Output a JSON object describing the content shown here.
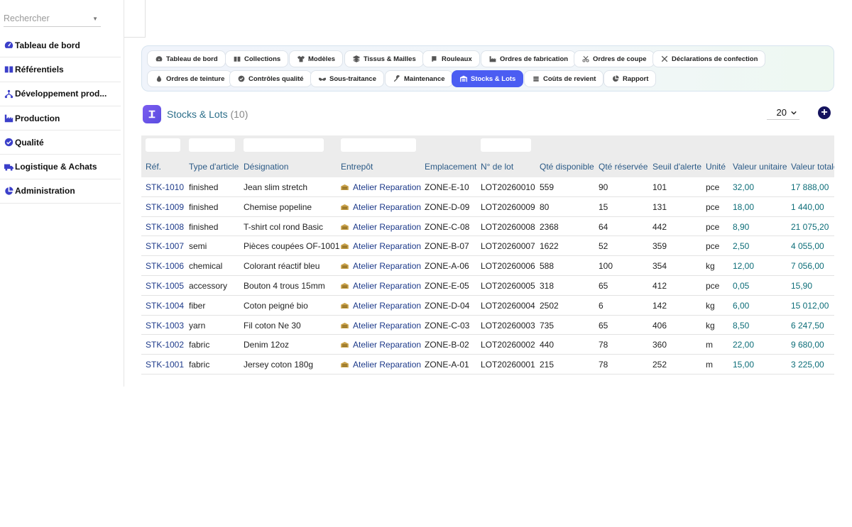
{
  "sidebar": {
    "search_placeholder": "Rechercher",
    "items": [
      {
        "label": "Tableau de bord",
        "icon": "gauge-icon"
      },
      {
        "label": "Référentiels",
        "icon": "book-icon"
      },
      {
        "label": "Développement prod...",
        "icon": "sitemap-icon"
      },
      {
        "label": "Production",
        "icon": "industry-icon"
      },
      {
        "label": "Qualité",
        "icon": "check-circle-icon"
      },
      {
        "label": "Logistique & Achats",
        "icon": "truck-icon"
      },
      {
        "label": "Administration",
        "icon": "pie-icon"
      }
    ]
  },
  "tabs": [
    {
      "label": "Tableau de bord",
      "icon": "gauge-icon"
    },
    {
      "label": "Collections",
      "icon": "book-icon"
    },
    {
      "label": "Modèles",
      "icon": "shirt-icon"
    },
    {
      "label": "Tissus & Mailles",
      "icon": "layers-icon"
    },
    {
      "label": "Rouleaux",
      "icon": "scroll-icon"
    },
    {
      "label": "Ordres de fabrication",
      "icon": "industry-icon"
    },
    {
      "label": "Ordres de coupe",
      "icon": "scissors-icon"
    },
    {
      "label": "Déclarations de confection",
      "icon": "tools-icon"
    },
    {
      "label": "Ordres de teinture",
      "icon": "droplet-icon"
    },
    {
      "label": "Contrôles qualité",
      "icon": "check-circle-icon"
    },
    {
      "label": "Sous-traitance",
      "icon": "handshake-icon"
    },
    {
      "label": "Maintenance",
      "icon": "wrench-icon"
    },
    {
      "label": "Stocks & Lots",
      "icon": "warehouse-icon",
      "active": true
    },
    {
      "label": "Coûts de revient",
      "icon": "coins-icon"
    },
    {
      "label": "Rapport",
      "icon": "pie-icon"
    }
  ],
  "section": {
    "title": "Stocks & Lots",
    "count": "(10)",
    "page_size": "20"
  },
  "colors": {
    "accent": "#4b5df2",
    "link": "#1d3a8a",
    "money": "#0c6d78",
    "header_text": "#2b5a86"
  },
  "table": {
    "columns": [
      "Réf.",
      "Type d'article",
      "Désignation",
      "Entrepôt",
      "Emplacement",
      "N° de lot",
      "Qté disponible",
      "Qté réservée",
      "Seuil d'alerte",
      "Unité",
      "Valeur unitaire",
      "Valeur totale"
    ],
    "rows": [
      [
        "STK-1010",
        "finished",
        "Jean slim stretch",
        "Atelier Reparation",
        "ZONE-E-10",
        "LOT20260010",
        "559",
        "90",
        "101",
        "pce",
        "32,00",
        "17 888,00"
      ],
      [
        "STK-1009",
        "finished",
        "Chemise popeline",
        "Atelier Reparation",
        "ZONE-D-09",
        "LOT20260009",
        "80",
        "15",
        "131",
        "pce",
        "18,00",
        "1 440,00"
      ],
      [
        "STK-1008",
        "finished",
        "T-shirt col rond Basic",
        "Atelier Reparation",
        "ZONE-C-08",
        "LOT20260008",
        "2368",
        "64",
        "442",
        "pce",
        "8,90",
        "21 075,20"
      ],
      [
        "STK-1007",
        "semi",
        "Pièces coupées OF-1001",
        "Atelier Reparation",
        "ZONE-B-07",
        "LOT20260007",
        "1622",
        "52",
        "359",
        "pce",
        "2,50",
        "4 055,00"
      ],
      [
        "STK-1006",
        "chemical",
        "Colorant réactif bleu",
        "Atelier Reparation",
        "ZONE-A-06",
        "LOT20260006",
        "588",
        "100",
        "354",
        "kg",
        "12,00",
        "7 056,00"
      ],
      [
        "STK-1005",
        "accessory",
        "Bouton 4 trous 15mm",
        "Atelier Reparation",
        "ZONE-E-05",
        "LOT20260005",
        "318",
        "65",
        "412",
        "pce",
        "0,05",
        "15,90"
      ],
      [
        "STK-1004",
        "fiber",
        "Coton peigné bio",
        "Atelier Reparation",
        "ZONE-D-04",
        "LOT20260004",
        "2502",
        "6",
        "142",
        "kg",
        "6,00",
        "15 012,00"
      ],
      [
        "STK-1003",
        "yarn",
        "Fil coton Ne 30",
        "Atelier Reparation",
        "ZONE-C-03",
        "LOT20260003",
        "735",
        "65",
        "406",
        "kg",
        "8,50",
        "6 247,50"
      ],
      [
        "STK-1002",
        "fabric",
        "Denim 12oz",
        "Atelier Reparation",
        "ZONE-B-02",
        "LOT20260002",
        "440",
        "78",
        "360",
        "m",
        "22,00",
        "9 680,00"
      ],
      [
        "STK-1001",
        "fabric",
        "Jersey coton 180g",
        "Atelier Reparation",
        "ZONE-A-01",
        "LOT20260001",
        "215",
        "78",
        "252",
        "m",
        "15,00",
        "3 225,00"
      ]
    ]
  }
}
